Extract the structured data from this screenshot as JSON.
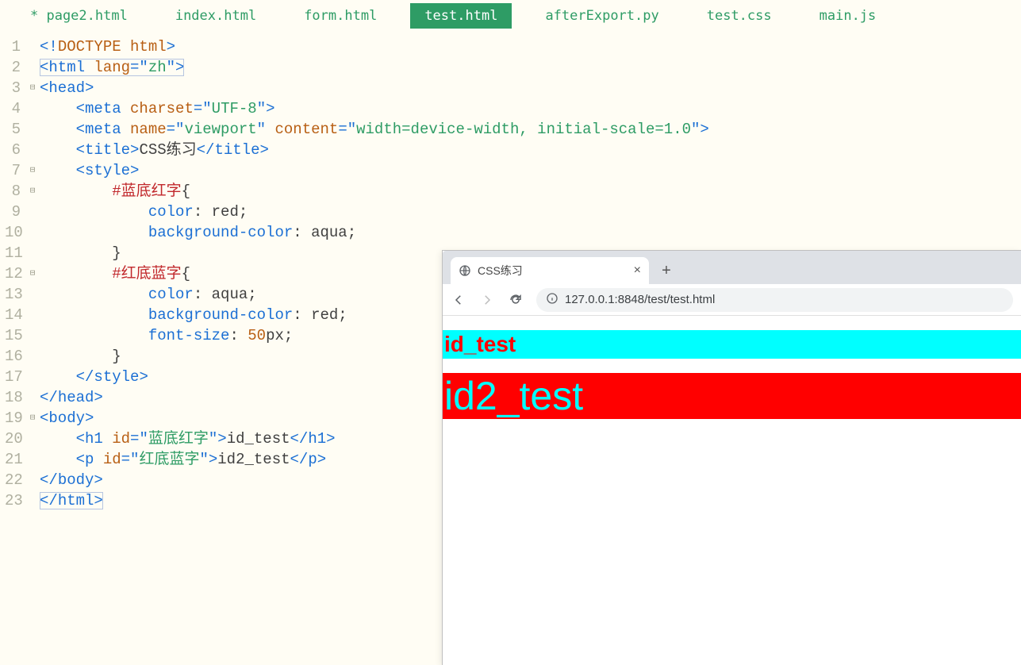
{
  "tabs": [
    {
      "label": "* page2.html",
      "active": false
    },
    {
      "label": "index.html",
      "active": false
    },
    {
      "label": "form.html",
      "active": false
    },
    {
      "label": "test.html",
      "active": true
    },
    {
      "label": "afterExport.py",
      "active": false
    },
    {
      "label": "test.css",
      "active": false
    },
    {
      "label": "main.js",
      "active": false
    }
  ],
  "gutter_fold": {
    "3": "⊟",
    "7": "⊟",
    "8": "⊟",
    "12": "⊟",
    "19": "⊟"
  },
  "code": {
    "l1": {
      "a": "<!",
      "b": "DOCTYPE ",
      "c": "html",
      "d": ">"
    },
    "l2": {
      "a": "<",
      "b": "html ",
      "c": "lang",
      "d": "=\"",
      "e": "zh",
      "f": "\">"
    },
    "l3": {
      "a": "<",
      "b": "head",
      "c": ">"
    },
    "l4": {
      "indent": "    ",
      "a": "<",
      "b": "meta ",
      "c": "charset",
      "d": "=\"",
      "e": "UTF-8",
      "f": "\">"
    },
    "l5": {
      "indent": "    ",
      "a": "<",
      "b": "meta ",
      "c": "name",
      "d": "=\"",
      "e": "viewport",
      "f": "\" ",
      "g": "content",
      "h": "=\"",
      "i": "width=device-width, initial-scale=1.0",
      "j": "\">"
    },
    "l6": {
      "indent": "    ",
      "a": "<",
      "b": "title",
      "c": ">",
      "d": "CSS练习",
      "e": "</",
      "f": "title",
      "g": ">"
    },
    "l7": {
      "indent": "    ",
      "a": "<",
      "b": "style",
      "c": ">"
    },
    "l8": {
      "indent": "        ",
      "a": "#蓝底红字",
      "b": "{"
    },
    "l9": {
      "indent": "            ",
      "a": "color",
      "b": ": ",
      "c": "red",
      "d": ";"
    },
    "l10": {
      "indent": "            ",
      "a": "background-color",
      "b": ": ",
      "c": "aqua",
      "d": ";"
    },
    "l11": {
      "indent": "        ",
      "a": "}"
    },
    "l12": {
      "indent": "        ",
      "a": "#红底蓝字",
      "b": "{"
    },
    "l13": {
      "indent": "            ",
      "a": "color",
      "b": ": ",
      "c": "aqua",
      "d": ";"
    },
    "l14": {
      "indent": "            ",
      "a": "background-color",
      "b": ": ",
      "c": "red",
      "d": ";"
    },
    "l15": {
      "indent": "            ",
      "a": "font-size",
      "b": ": ",
      "c": "50",
      "d": "px",
      "e": ";"
    },
    "l16": {
      "indent": "        ",
      "a": "}"
    },
    "l17": {
      "indent": "    ",
      "a": "</",
      "b": "style",
      "c": ">"
    },
    "l18": {
      "a": "</",
      "b": "head",
      "c": ">"
    },
    "l19": {
      "a": "<",
      "b": "body",
      "c": ">"
    },
    "l20": {
      "indent": "    ",
      "a": "<",
      "b": "h1 ",
      "c": "id",
      "d": "=\"",
      "e": "蓝底红字",
      "f": "\">",
      "g": "id_test",
      "h": "</",
      "i": "h1",
      "j": ">"
    },
    "l21": {
      "indent": "    ",
      "a": "<",
      "b": "p ",
      "c": "id",
      "d": "=\"",
      "e": "红底蓝字",
      "f": "\">",
      "g": "id2_test",
      "h": "</",
      "i": "p",
      "j": ">"
    },
    "l22": {
      "a": "</",
      "b": "body",
      "c": ">"
    },
    "l23": {
      "a": "</",
      "b": "html",
      "c": ">"
    }
  },
  "line_numbers": [
    "1",
    "2",
    "3",
    "4",
    "5",
    "6",
    "7",
    "8",
    "9",
    "10",
    "11",
    "12",
    "13",
    "14",
    "15",
    "16",
    "17",
    "18",
    "19",
    "20",
    "21",
    "22",
    "23"
  ],
  "browser": {
    "tab_title": "CSS练习",
    "url": "127.0.0.1:8848/test/test.html",
    "rendered": {
      "h1_text": "id_test",
      "p_text": "id2_test"
    }
  }
}
